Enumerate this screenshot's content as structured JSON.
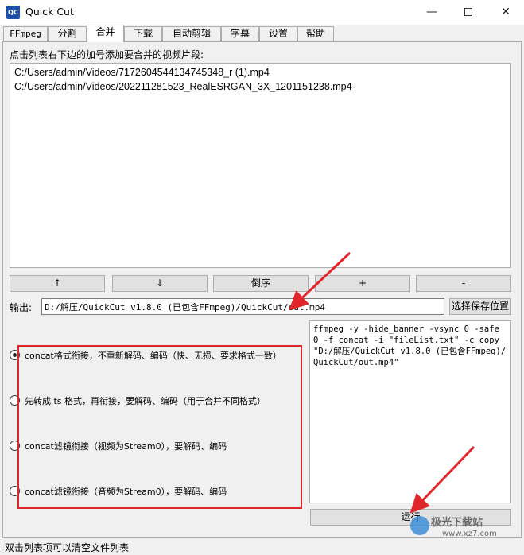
{
  "window": {
    "icon_text": "QC",
    "title": "Quick Cut",
    "minimize": "—",
    "close": "✕"
  },
  "tabs": [
    "FFmpeg",
    "分割",
    "合并",
    "下载",
    "自动剪辑",
    "字幕",
    "设置",
    "帮助"
  ],
  "active_tab": "合并",
  "merge": {
    "instruction": "点击列表右下边的加号添加要合并的视频片段:",
    "files": [
      "C:/Users/admin/Videos/7172604544134745348_r (1).mp4",
      "C:/Users/admin/Videos/202211281523_RealESRGAN_3X_1201151238.mp4"
    ],
    "buttons": {
      "up": "↑",
      "down": "↓",
      "reverse": "倒序",
      "add": "+",
      "remove": "-"
    },
    "output_label": "输出:",
    "output_value": "D:/解压/QuickCut v1.8.0 (已包含FFmpeg)/QuickCut/out.mp4",
    "choose_location": "选择保存位置",
    "options": [
      "concat格式衔接，不重新解码、编码（快、无损、要求格式一致）",
      "先转成 ts 格式，再衔接，要解码、编码（用于合并不同格式）",
      "concat滤镜衔接（视频为Stream0），要解码、编码",
      "concat滤镜衔接（音频为Stream0），要解码、编码"
    ],
    "selected_option": 0,
    "command": "ffmpeg -y -hide_banner -vsync 0 -safe 0 -f concat -i \"fileList.txt\" -c copy \"D:/解压/QuickCut v1.8.0 (已包含FFmpeg)/QuickCut/out.mp4\"",
    "run_label": "运行"
  },
  "status": "双击列表项可以清空文件列表",
  "watermark": {
    "line1": "极光下载站",
    "line2": "www.xz7.com"
  },
  "colors": {
    "annotation_red": "#e0262b",
    "window_bg": "#f0f0f0"
  }
}
